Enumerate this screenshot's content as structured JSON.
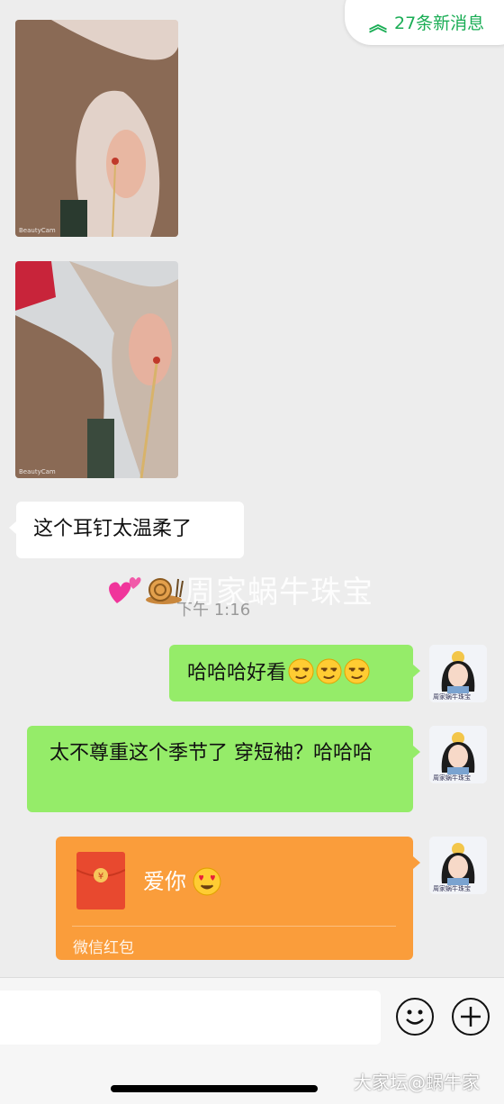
{
  "new_messages": {
    "label": "27条新消息"
  },
  "photos": [
    {
      "watermark": "BeautyCam"
    },
    {
      "watermark": "BeautyCam"
    }
  ],
  "messages": {
    "incoming_text": "这个耳钉太温柔了",
    "timestamp": "下午 1:16",
    "watermark": "周家蜗牛珠宝",
    "outgoing_1_text": "哈哈哈好看",
    "outgoing_2_text": "太不尊重这个季节了 穿短袖？哈哈哈",
    "red_packet": {
      "text": "爱你",
      "caption": "微信红包"
    }
  },
  "avatar": {
    "caption": "周家蜗牛珠宝"
  },
  "input_bar": {
    "input_value": "",
    "emoji_icon": "smile-icon",
    "plus_icon": "plus-icon"
  },
  "site_mark": "大家坛@蜗牛家"
}
